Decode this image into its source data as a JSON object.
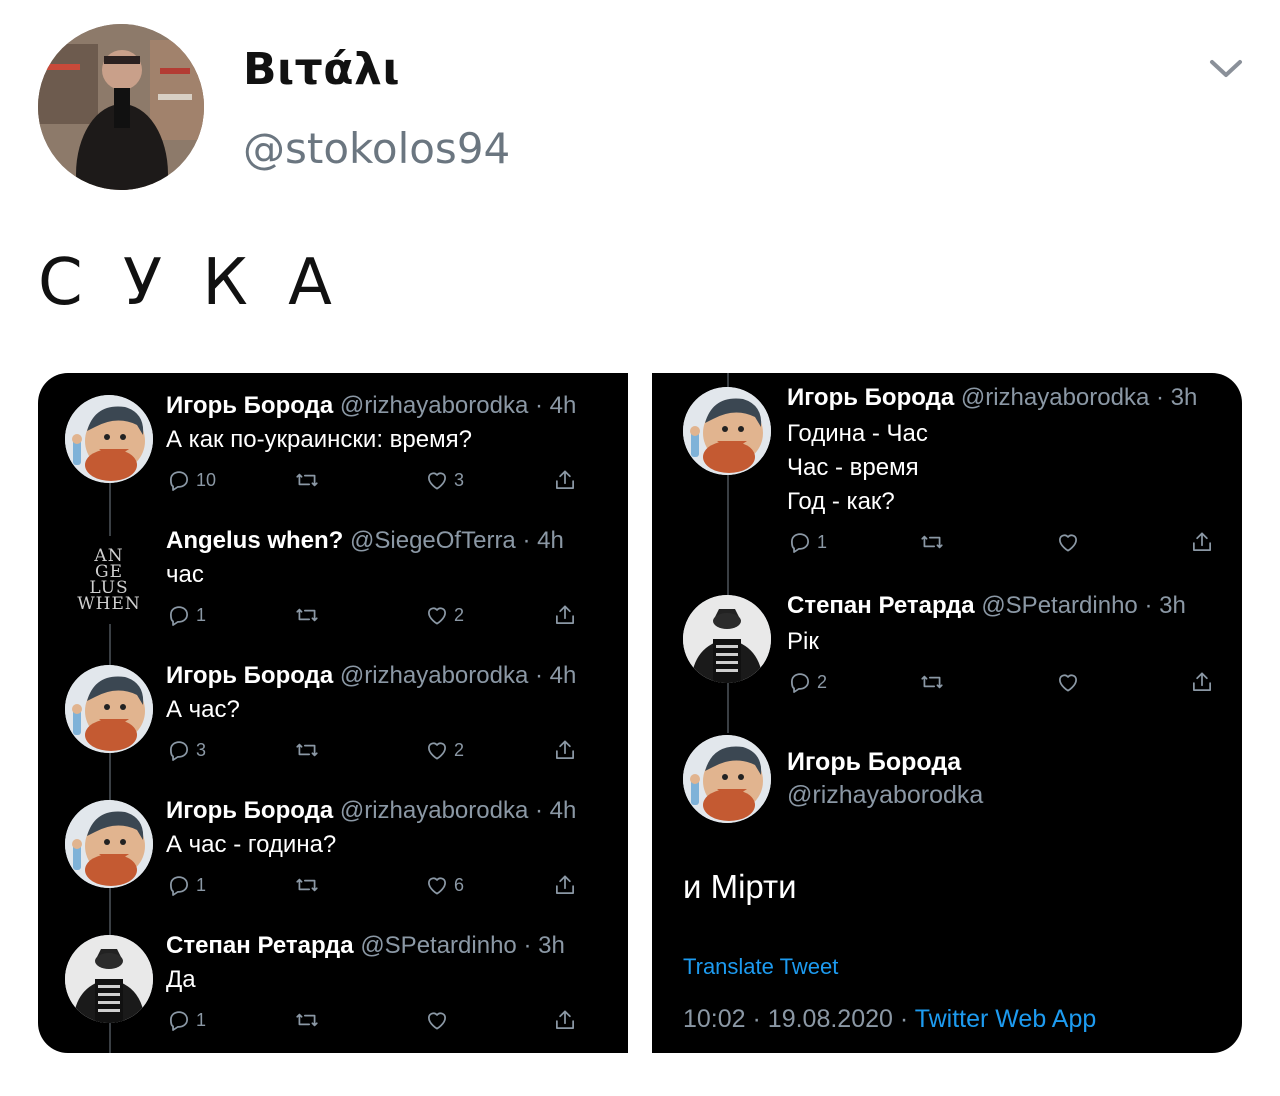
{
  "tweet": {
    "author_name": "Βιτάλι",
    "author_handle": "@stokolos94",
    "text": "С У К А"
  },
  "left_panel": {
    "replies": [
      {
        "name": "Игорь Борода",
        "handle": "@rizhayaborodka",
        "sep": "·",
        "time": "4h",
        "lines": [
          "А как по-украински: время?"
        ],
        "reply_count": "10",
        "retweet_count": "",
        "like_count": "3"
      },
      {
        "name": "Angelus when?",
        "handle": "@SiegeOfTerra",
        "sep": "·",
        "time": "4h",
        "avatar_text": [
          "AN",
          "GE",
          "LUS",
          "WHEN"
        ],
        "lines": [
          "час"
        ],
        "reply_count": "1",
        "retweet_count": "",
        "like_count": "2"
      },
      {
        "name": "Игорь Борода",
        "handle": "@rizhayaborodka",
        "sep": "·",
        "time": "4h",
        "lines": [
          "А час?"
        ],
        "reply_count": "3",
        "retweet_count": "",
        "like_count": "2"
      },
      {
        "name": "Игорь Борода",
        "handle": "@rizhayaborodka",
        "sep": "·",
        "time": "4h",
        "lines": [
          "А час - година?"
        ],
        "reply_count": "1",
        "retweet_count": "",
        "like_count": "6"
      },
      {
        "name": "Степан Ретарда",
        "handle": "@SPetardinho",
        "sep": "·",
        "time": "3h",
        "lines": [
          "Да"
        ],
        "reply_count": "1",
        "retweet_count": "",
        "like_count": ""
      }
    ]
  },
  "right_panel": {
    "replies": [
      {
        "name": "Игорь Борода",
        "handle": "@rizhayaborodka",
        "sep": "·",
        "time": "3h",
        "lines": [
          "Година - Час",
          "Час - время",
          "Год - как?"
        ],
        "reply_count": "1",
        "retweet_count": "",
        "like_count": ""
      },
      {
        "name": "Степан Ретарда",
        "handle": "@SPetardinho",
        "sep": "·",
        "time": "3h",
        "lines": [
          "Рік"
        ],
        "reply_count": "2",
        "retweet_count": "",
        "like_count": ""
      }
    ],
    "focus": {
      "name": "Игорь Борода",
      "handle": "@rizhayaborodka",
      "text": "и Мірти",
      "translate": "Translate Tweet",
      "time": "10:02",
      "dot1": "·",
      "date": "19.08.2020",
      "dot2": "·",
      "app": "Twitter Web App"
    }
  },
  "colors": {
    "panel_bg": "#000000",
    "secondary_text": "#8b98a5",
    "link": "#1d9bf0"
  },
  "icons": [
    "chevron-down-icon",
    "reply-icon",
    "retweet-icon",
    "like-icon",
    "share-icon"
  ]
}
